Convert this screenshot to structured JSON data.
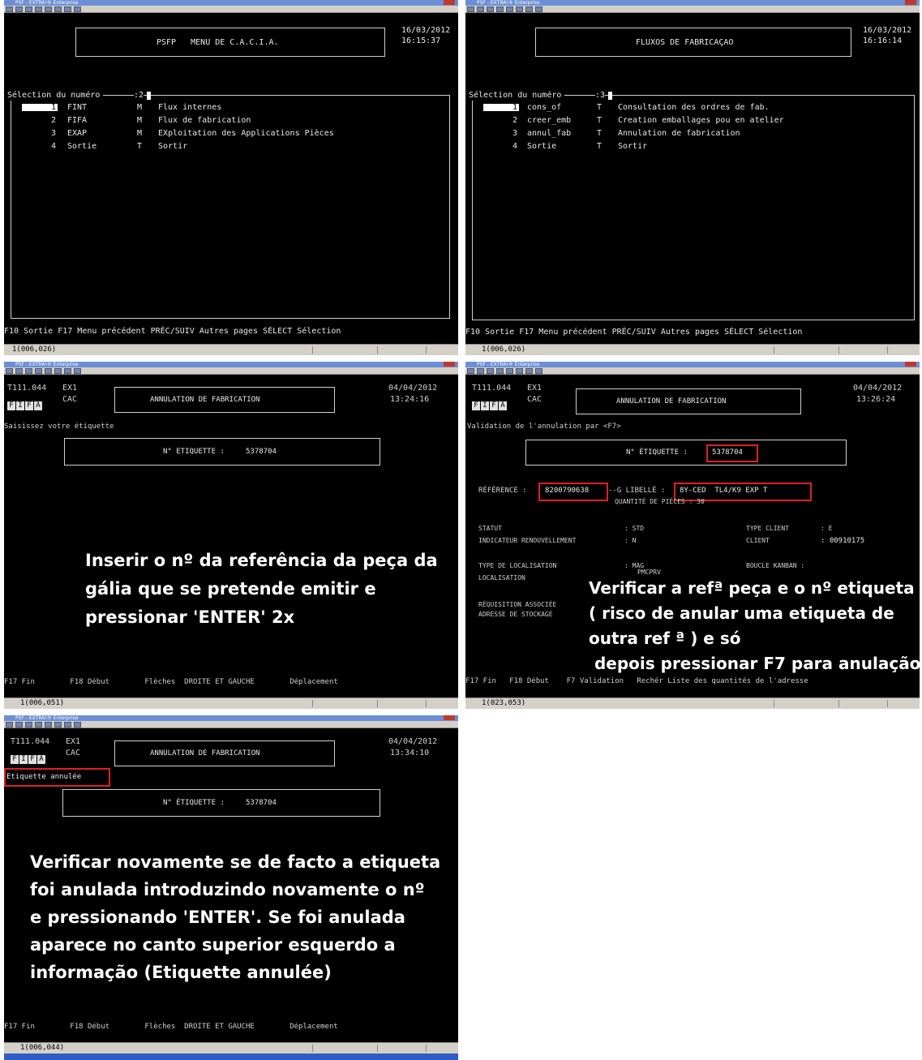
{
  "panel1": {
    "date": "16/03/2012",
    "time": "16:15:37",
    "title": "PSFP   MENU DE C.A.C.I.A.",
    "selection_label": "Sélection du numéro",
    "selection_value": ":2",
    "items": [
      {
        "num": "1",
        "code": "FINT",
        "type": "M",
        "desc": "Flux internes"
      },
      {
        "num": "2",
        "code": "FIFA",
        "type": "M",
        "desc": "Flux de fabrication"
      },
      {
        "num": "3",
        "code": "EXAP",
        "type": "M",
        "desc": "EXploitation des Applications Pièces"
      },
      {
        "num": "4",
        "code": "Sortie",
        "type": "T",
        "desc": "Sortir"
      }
    ],
    "footer": "F10 Sortie F17 Menu précédent PRÉC/SUIV Autres pages SÉLECT Sélection",
    "status": "1(006,026)"
  },
  "panel2": {
    "date": "16/03/2012",
    "time": "16:16:14",
    "title": "FLUXOS DE FABRICAÇAO",
    "selection_label": "Sélection du numéro",
    "selection_value": ":3",
    "items": [
      {
        "num": "1",
        "code": "cons_of",
        "type": "T",
        "desc": "Consultation des ordres de fab."
      },
      {
        "num": "2",
        "code": "creer_emb",
        "type": "T",
        "desc": "Creation emballages pou en atelier"
      },
      {
        "num": "3",
        "code": "annul_fab",
        "type": "T",
        "desc": "Annulation de fabrication"
      },
      {
        "num": "4",
        "code": "Sortie",
        "type": "T",
        "desc": "Sortir"
      }
    ],
    "footer": "F10 Sortie F17 Menu précédent PRÉC/SUIV Autres pages SÉLECT Sélection",
    "status": "1(006,026)"
  },
  "panel3": {
    "trans": "T111.044",
    "env": "EX1",
    "sub": "CAC",
    "fifa": [
      "F",
      "I",
      "F",
      "A"
    ],
    "date": "04/04/2012",
    "time": "13:24:16",
    "title": "ANNULATION DE FABRICATION",
    "message": "Saisissez votre étiquette",
    "etiq_label": "N° ETIQUETTE :",
    "etiq_value": "5378704",
    "caption": "Inserir o nº da referência da peça da\ngália que se pretende emitir e\npressionar 'ENTER' 2x",
    "footer": "F17 Fin        F18 Début        Flèches  DROITE ET GAUCHE        Déplacement",
    "status": "1(006,051)"
  },
  "panel4": {
    "trans": "T111.044",
    "env": "EX1",
    "sub": "CAC",
    "fifa": [
      "F",
      "I",
      "F",
      "A"
    ],
    "date": "04/04/2012",
    "time": "13:26:24",
    "title": "ANNULATION DE FABRICATION",
    "message": "Validation de l'annulation par <F7>",
    "etiq_label": "N° ÉTIQUETTE :",
    "etiq_value": "5378704",
    "reference_label": "RÉFÉRENCE :",
    "reference_value": "8200790638",
    "libelle_prefix": "--G LIBELLÉ :",
    "libelle_value": "8Y-CED  TL4/K9 EXP T",
    "quantite": "QUANTITÉ DE PIÈCES : 30",
    "statut_label": "STATUT",
    "statut_value": ": STD",
    "type_client_label": "TYPE CLIENT",
    "type_client_value": ": E",
    "indicateur_label": "INDICATEUR RENOUVELLEMENT",
    "indicateur_value": ": N",
    "client_label": "CLIENT",
    "client_value": ": 00910175",
    "type_loc_label": "TYPE DE LOCALISATION",
    "type_loc_value": ": MAG",
    "boucle_label": "BOUCLE KANBAN :",
    "localisation_label": "LOCALISATION",
    "localisation_value": "PMCPRV",
    "requisition_label": "RÉQUISITION ASSOCIÉE",
    "adresse_label": "ADRESSE DE STOCKAGE",
    "caption": "Verificar a refª peça e o nº etiqueta\n( risco de anular uma etiqueta de\noutra ref ª ) e só\n depois pressionar F7 para anulação",
    "footer": "F17 Fin   F18 Début    F7 Validation   Rechér Liste des quantités de l'adresse",
    "status": "1(023,053)"
  },
  "panel5": {
    "trans": "T111.044",
    "env": "EX1",
    "sub": "CAC",
    "fifa": [
      "F",
      "I",
      "F",
      "A"
    ],
    "date": "04/04/2012",
    "time": "13:34:10",
    "title": "ANNULATION DE FABRICATION",
    "message": "Etiquette annulée",
    "etiq_label": "N° ÉTIQUETTE :",
    "etiq_value": "5378704",
    "caption": "Verificar novamente se de facto a etiqueta\nfoi anulada introduzindo novamente o nº\ne pressionando 'ENTER'. Se foi anulada\naparece no canto superior esquerdo a\ninformação (Etiquette annulée)",
    "footer": "F17 Fin        F18 Début        Flèches  DROITE ET GAUCHE        Déplacement",
    "status": "1(006,044)"
  }
}
